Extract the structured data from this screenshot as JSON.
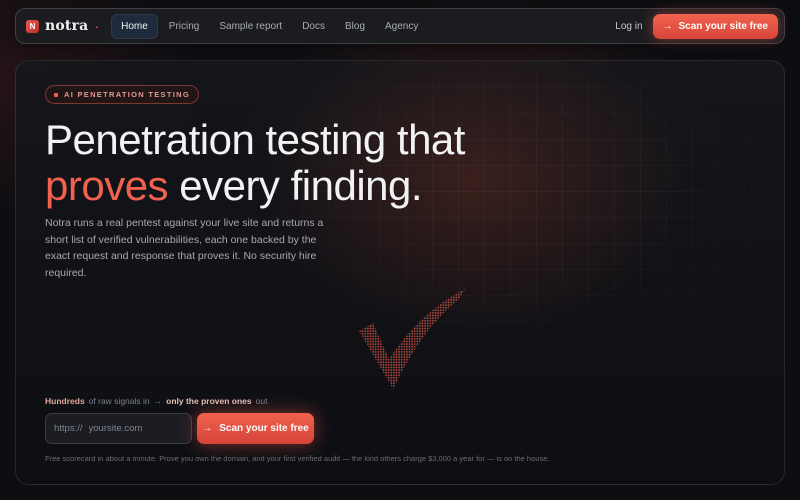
{
  "brand": {
    "name": "notra",
    "logo_letter": "N",
    "accent_color": "#f0624d"
  },
  "nav": {
    "links": [
      {
        "label": "Home",
        "active": true
      },
      {
        "label": "Pricing"
      },
      {
        "label": "Sample report"
      },
      {
        "label": "Docs"
      },
      {
        "label": "Blog"
      },
      {
        "label": "Agency"
      }
    ],
    "login_label": "Log in",
    "cta_label": "Scan your site free",
    "cta_icon": "arrow-right-icon"
  },
  "hero": {
    "badge": "AI PENETRATION TESTING",
    "headline_line1": "Penetration testing that",
    "headline_accent": "proves",
    "headline_rest": " every finding.",
    "description": "Notra runs a real pentest against your live site and returns a short list of verified vulnerabilities, each one backed by the exact request and response that proves it. No security hire required.",
    "signals": {
      "part1": "Hundreds",
      "part2": "of raw signals in",
      "arrow": "→",
      "part3": "only the proven ones",
      "part4": "out"
    },
    "input": {
      "prefix": "https://",
      "placeholder": "yoursite.com"
    },
    "scan_button_label": "Scan your site free",
    "fineprint": "Free scorecard in about a minute. Prove you own the domain, and your first verified audit — the kind others charge $3,000 a year for — is on the house."
  },
  "colors": {
    "background": "#0d0e12",
    "accent": "#f0624d",
    "nav_active": "#1f2a3c"
  }
}
